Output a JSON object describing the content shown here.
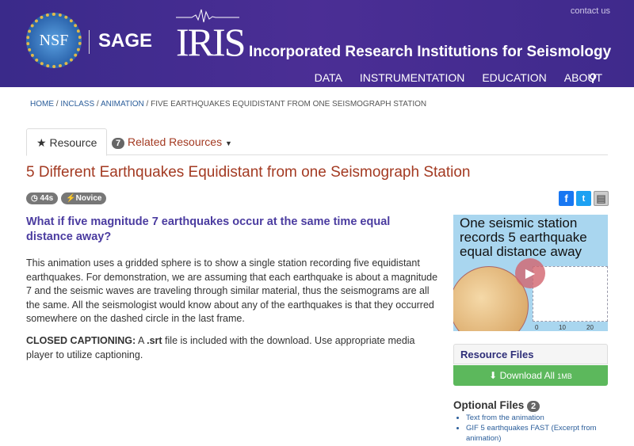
{
  "header": {
    "contact": "contact us",
    "nsf": "NSF",
    "sage": "SAGE",
    "iris": "IRIS",
    "org": "Incorporated Research Institutions for Seismology",
    "nav": [
      "DATA",
      "INSTRUMENTATION",
      "EDUCATION",
      "ABOUT"
    ]
  },
  "breadcrumb": [
    "HOME",
    "INCLASS",
    "ANIMATION",
    "FIVE EARTHQUAKES EQUIDISTANT FROM ONE SEISMOGRAPH STATION"
  ],
  "tabs": {
    "resource": "Resource",
    "related_count": "7",
    "related": "Related Resources"
  },
  "title": "5 Different Earthquakes Equidistant from one Seismograph Station",
  "pills": {
    "duration": "44s",
    "level": "Novice"
  },
  "question": "What if five magnitude 7 earthquakes occur at the same time equal distance away?",
  "description": "This animation uses a gridded sphere is to show a single station recording five equidistant earthquakes. For demonstration, we are assuming that each earthquake is about a magnitude 7 and the seismic waves are traveling through similar material, thus the seismograms are all the same. All the seismologist would know about any of the earthquakes is that they occurred somewhere on the dashed circle in the last frame.",
  "captioning": {
    "label": "CLOSED CAPTIONING:",
    "pre": " A ",
    "srt": ".srt",
    "post": " file is included with the download. Use appropriate media player to utilize captioning."
  },
  "thumbnail": {
    "text": "One seismic station records 5 earthquake equal distance away",
    "ticks": [
      "0",
      "10",
      "20"
    ]
  },
  "resource_files": {
    "title": "Resource Files",
    "download": "Download All",
    "size": "1MB"
  },
  "optional": {
    "title": "Optional Files",
    "count": "2",
    "items": [
      "Text from the animation",
      "GIF 5 earthquakes FAST (Excerpt from animation)"
    ]
  }
}
